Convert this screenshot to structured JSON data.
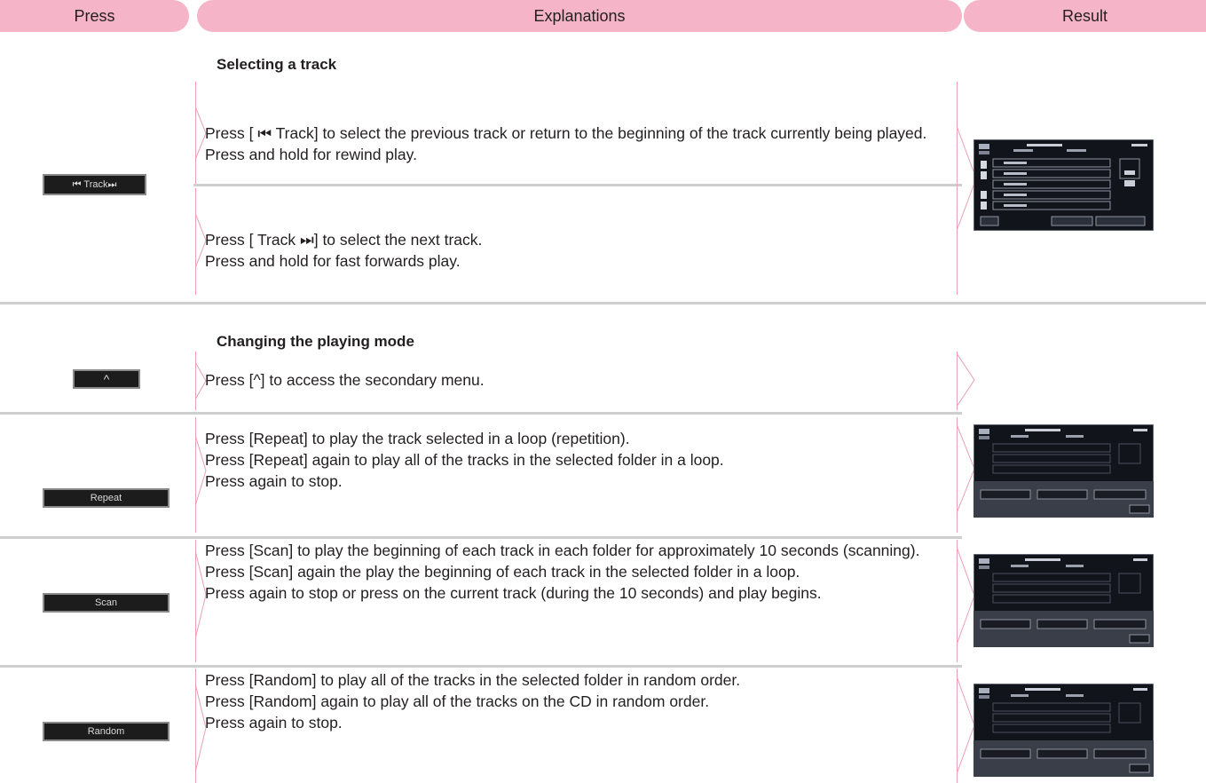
{
  "headers": {
    "press": "Press",
    "explanations": "Explanations",
    "result": "Result"
  },
  "section1": {
    "title": "Selecting a track",
    "button_label": "⏮ Track⏭",
    "prev_lines": [
      "Press [ ⏮  Track] to select the previous track or return to the beginning of the track currently being played.",
      "Press and hold for rewind play."
    ],
    "next_lines": [
      "Press [ Track ⏭] to select the next track.",
      "Press and hold for fast forwards play."
    ]
  },
  "section2": {
    "title": "Changing the playing mode",
    "menu_button_label": "^",
    "menu_text": "Press [^] to access the secondary menu.",
    "rows": [
      {
        "button_label": "Repeat",
        "lines": [
          "Press [Repeat] to play the track selected in a loop (repetition).",
          "Press [Repeat] again to play all of the tracks in the selected folder in a loop.",
          "Press again to stop."
        ]
      },
      {
        "button_label": "Scan",
        "lines": [
          "Press [Scan] to play the beginning of each track in each folder for approximately 10 seconds (scanning).",
          "Press [Scan] again the play the beginning of each track in the selected folder in a loop.",
          "Press again to stop or press on the current track (during the 10 seconds) and play begins."
        ]
      },
      {
        "button_label": "Random",
        "lines": [
          "Press [Random] to play all of the tracks in the selected folder in random order.",
          "Press [Random] again to play all of the tracks on the CD in random order.",
          "Press again to stop."
        ]
      }
    ]
  },
  "colors": {
    "header_pink": "#f5b4c7",
    "divider_pink": "#e9a0b6",
    "rule_grey": "#cfcfcf",
    "button_dark": "#1c1c1c"
  }
}
